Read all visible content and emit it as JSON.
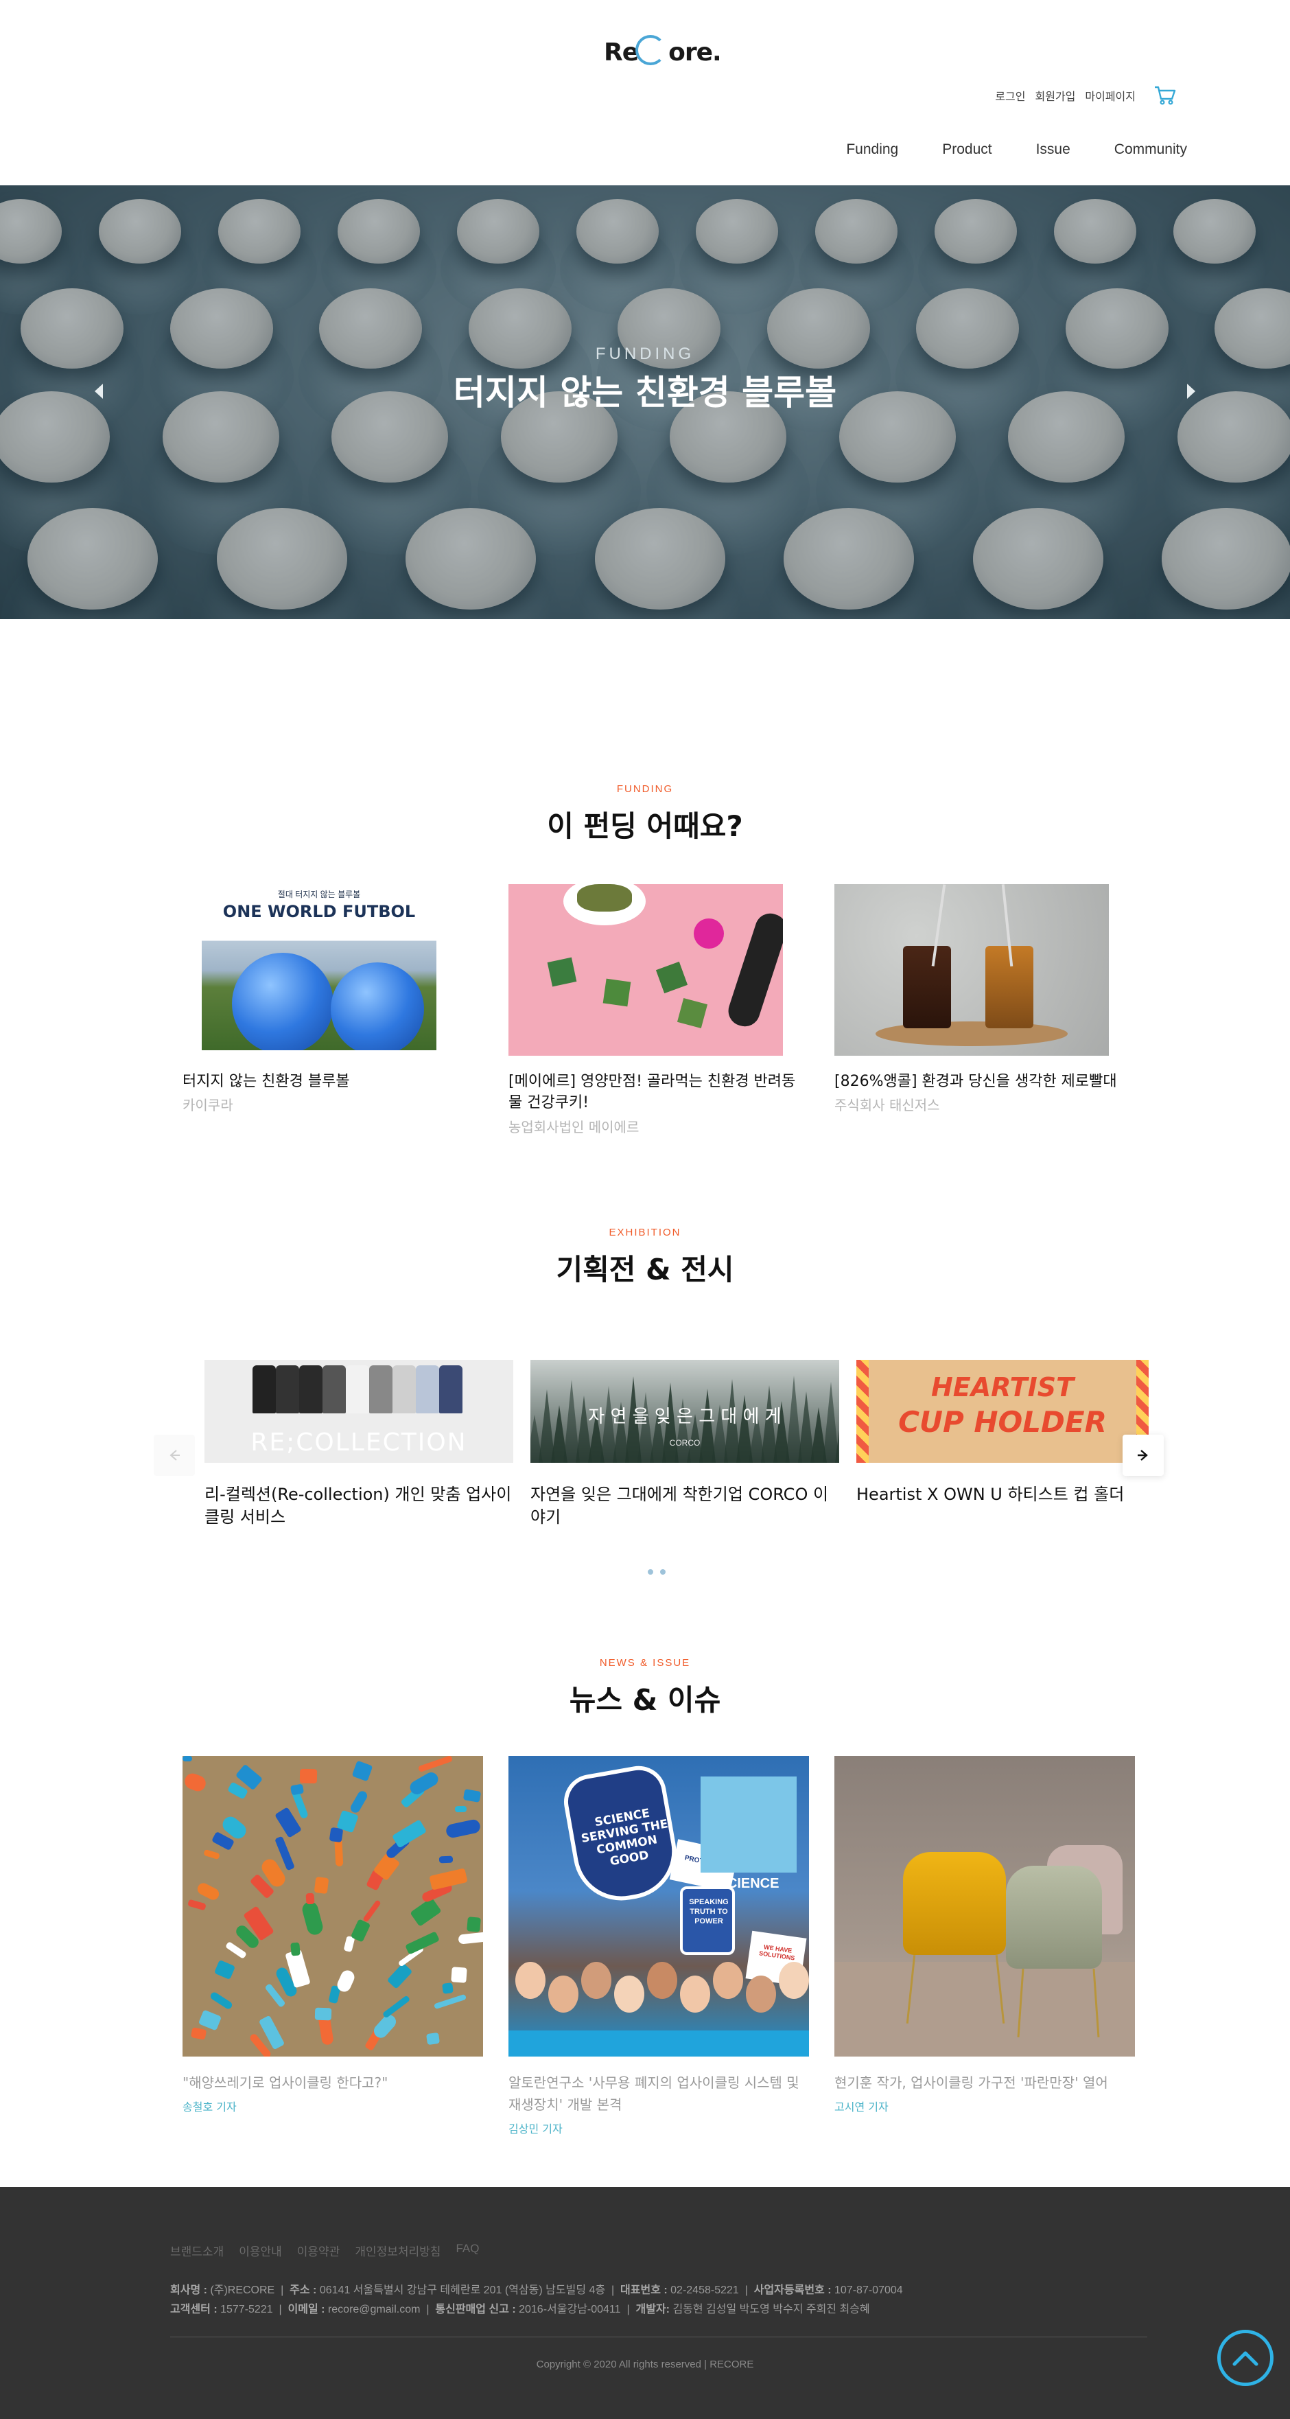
{
  "header": {
    "logo": "Re ore.",
    "util": {
      "login": "로그인",
      "signup": "회원가입",
      "mypage": "마이페이지"
    },
    "nav": [
      "Funding",
      "Product",
      "Issue",
      "Community"
    ]
  },
  "hero": {
    "kicker": "FUNDING",
    "title": "터지지 않는 친환경 블루볼"
  },
  "funding": {
    "kicker": "FUNDING",
    "title": "이 펀딩 어때요?",
    "items": [
      {
        "title": "터지지 않는 친환경 블루볼",
        "company": "카이쿠라",
        "img_caption_small": "절대 터지지 않는 블루볼",
        "img_caption": "ONE WORLD FUTBOL"
      },
      {
        "title": "[메이에르] 영양만점! 골라먹는 친환경 반려동물 건강쿠키!",
        "company": "농업회사법인 메이에르"
      },
      {
        "title": "[826%앵콜] 환경과 당신을 생각한 제로빨대",
        "company": "주식회사 태신저스"
      }
    ]
  },
  "exhibition": {
    "kicker": "EXHIBITION",
    "title": "기획전 & 전시",
    "items": [
      {
        "title": "리-컬렉션(Re-collection) 개인 맞춤 업사이클링 서비스",
        "img_text": "RE;COLLECTION"
      },
      {
        "title": "자연을 잊은 그대에게 착한기업 CORCO 이야기",
        "img_text": "자 연 을   잊 은   그 대 에 게",
        "img_sub": "CORCO"
      },
      {
        "title": "Heartist X OWN U 하티스트 컵 홀더",
        "img_text": "HEARTIST",
        "img_text2": "CUP HOLDER"
      }
    ]
  },
  "news": {
    "kicker": "NEWS & ISSUE",
    "title": "뉴스 & 이슈",
    "items": [
      {
        "title": "\"해양쓰레기로 업사이클링 한다고?\"",
        "author": "송철호 기자"
      },
      {
        "title": "알토란연구소 '사무용 폐지의 업사이클링 시스템 및 재생장치' 개발 본격",
        "author": "김상민 기자"
      },
      {
        "title": "현기훈 작가, 업사이클링 가구전 '파란만장' 열어",
        "author": "고시연 기자"
      }
    ],
    "sign_words": [
      "SCIENCE SERVING THE COMMON GOOD",
      "PROTECTING",
      "SCIENCE",
      "WE HAVE SOLUTIONS",
      "SPEAKING TRUTH TO POWER"
    ]
  },
  "footer": {
    "nav": [
      "브랜드소개",
      "이용안내",
      "이용약관",
      "개인정보처리방침",
      "FAQ"
    ],
    "line1": [
      {
        "label": "회사명 :",
        "value": "(주)RECORE"
      },
      {
        "label": "주소 :",
        "value": "06141 서울특별시 강남구 테헤란로 201 (역삼동) 남도빌딩 4층"
      },
      {
        "label": "대표번호 :",
        "value": "02-2458-5221"
      },
      {
        "label": "사업자등록번호 :",
        "value": "107-87-07004"
      }
    ],
    "line2": [
      {
        "label": "고객센터 :",
        "value": "1577-5221"
      },
      {
        "label": "이메일 :",
        "value": "recore@gmail.com"
      },
      {
        "label": "통신판매업 신고 :",
        "value": "2016-서울강남-00411"
      },
      {
        "label": "개발자:",
        "value": "김동현 김성일 박도영 박수지 주희진 최승혜"
      }
    ],
    "copyright": "Copyright © 2020 All rights reserved | RECORE"
  },
  "colors": {
    "accent": "#f05a28",
    "brand_blue": "#2fb3e6",
    "footer_bg": "#333333",
    "author": "#4ab3c8"
  }
}
